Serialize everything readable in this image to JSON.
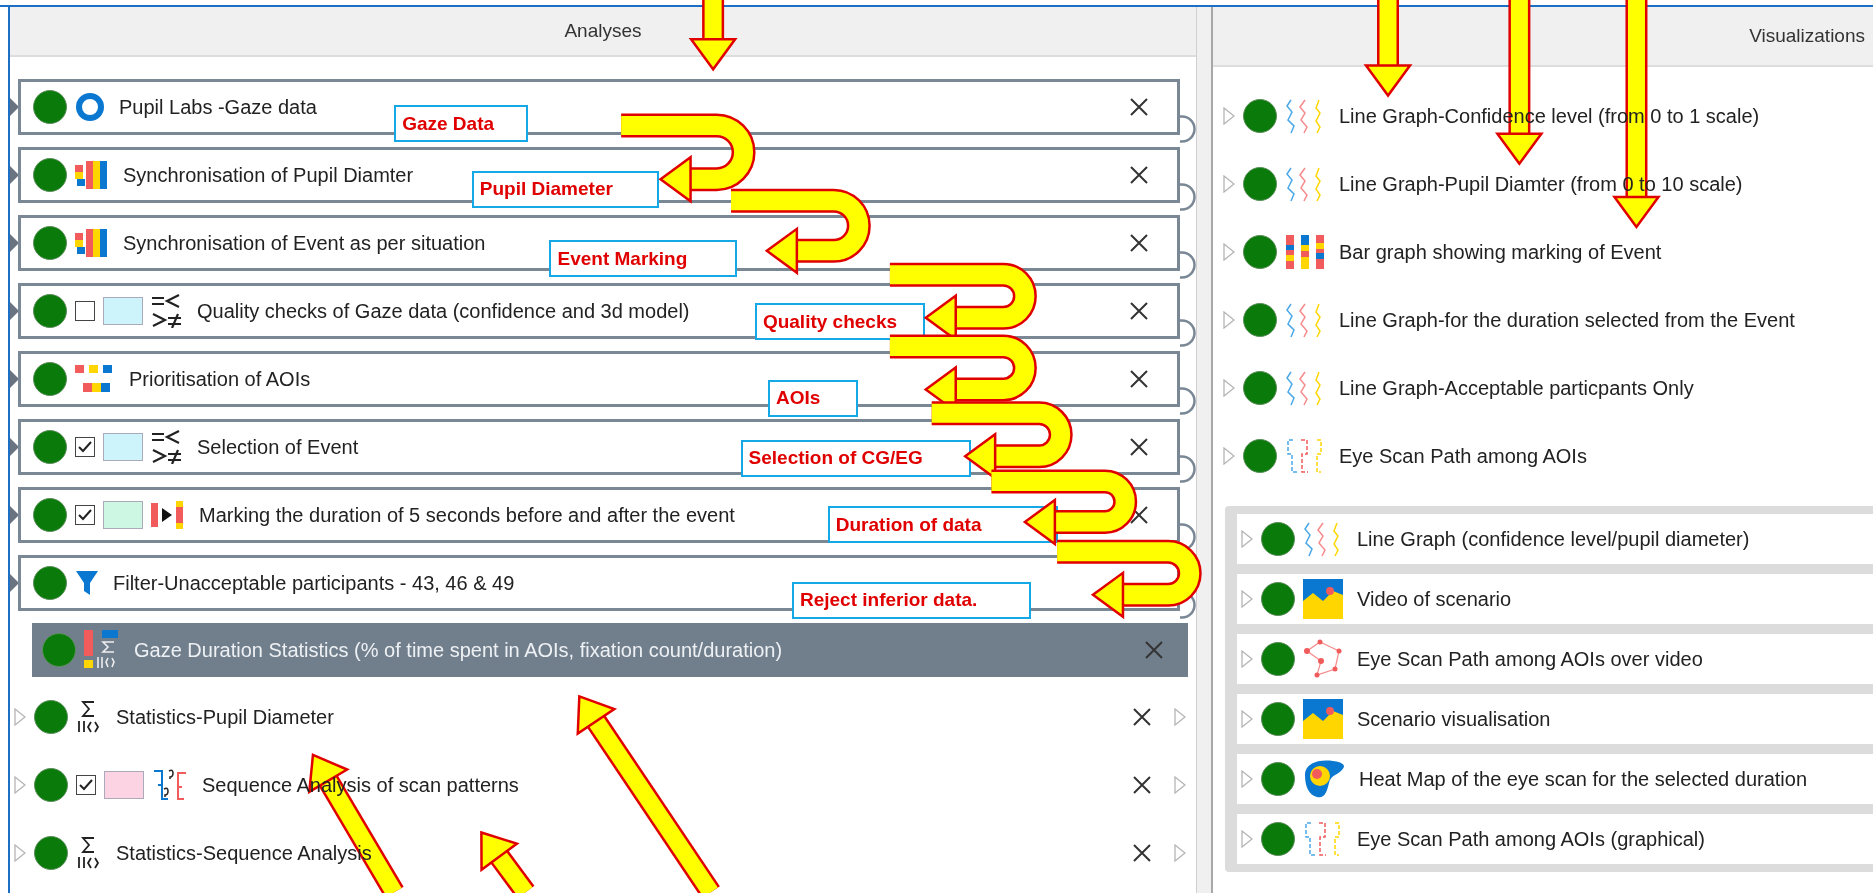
{
  "analyses": {
    "title": "Analyses",
    "chain": [
      {
        "kind": "ring",
        "label": "Pupil Labs -Gaze data",
        "close": true
      },
      {
        "kind": "sync",
        "label": "Synchronisation of Pupil Diamter",
        "close": true
      },
      {
        "kind": "sync",
        "label": "Synchronisation of Event as per situation",
        "close": true
      },
      {
        "kind": "compare",
        "label": "Quality checks of Gaze data (confidence and 3d model)",
        "checked": false,
        "color": "#cdf3fb",
        "close": true
      },
      {
        "kind": "prioritise",
        "label": "Prioritisation of AOIs",
        "close": true
      },
      {
        "kind": "compare",
        "label": "Selection of Event",
        "checked": true,
        "color": "#cdf3fb",
        "close": true
      },
      {
        "kind": "marking",
        "label": "Marking the duration of 5 seconds before and after the event",
        "checked": true,
        "color": "#cdf7e3",
        "close": true
      },
      {
        "kind": "filter",
        "label": "Filter-Unacceptable participants - 43, 46 & 49",
        "close": false
      }
    ],
    "items": [
      {
        "kind": "stats-color",
        "label": "Gaze Duration Statistics (% of time spent in AOIs, fixation count/duration)",
        "selected": true
      },
      {
        "kind": "stats",
        "label": "Statistics-Pupil Diameter",
        "selected": false
      },
      {
        "kind": "sequence",
        "label": "Sequence Analysis of scan patterns",
        "checked": true,
        "color": "#fcd3e2",
        "selected": false
      },
      {
        "kind": "stats",
        "label": "Statistics-Sequence Analysis",
        "selected": false
      }
    ]
  },
  "visualizations": {
    "title": "Visualizations",
    "items": [
      {
        "kind": "line",
        "label": "Line Graph-Confidence level (from 0 to 1 scale)"
      },
      {
        "kind": "line",
        "label": "Line Graph-Pupil Diamter (from 0 to 10 scale)"
      },
      {
        "kind": "bar",
        "label": "Bar graph showing marking of Event"
      },
      {
        "kind": "line",
        "label": "Line Graph-for the duration selected from the Event"
      },
      {
        "kind": "line",
        "label": "Line Graph-Acceptable particpants Only"
      },
      {
        "kind": "path",
        "label": "Eye Scan Path among AOIs"
      }
    ],
    "group": [
      {
        "kind": "line",
        "label": "Line Graph (confidence level/pupil diameter)"
      },
      {
        "kind": "image",
        "label": "Video of scenario"
      },
      {
        "kind": "scatter",
        "label": "Eye Scan Path among AOIs over video"
      },
      {
        "kind": "image",
        "label": "Scenario visualisation"
      },
      {
        "kind": "heatmap",
        "label": "Heat Map of the eye scan for the selected duration"
      },
      {
        "kind": "path",
        "label": "Eye Scan Path among AOIs (graphical)"
      }
    ]
  },
  "callouts": [
    "Gaze Data",
    "Pupil Diameter",
    "Event Marking",
    "Quality checks",
    "AOIs",
    "Selection of CG/EG",
    "Duration of data",
    "Reject inferior data."
  ]
}
